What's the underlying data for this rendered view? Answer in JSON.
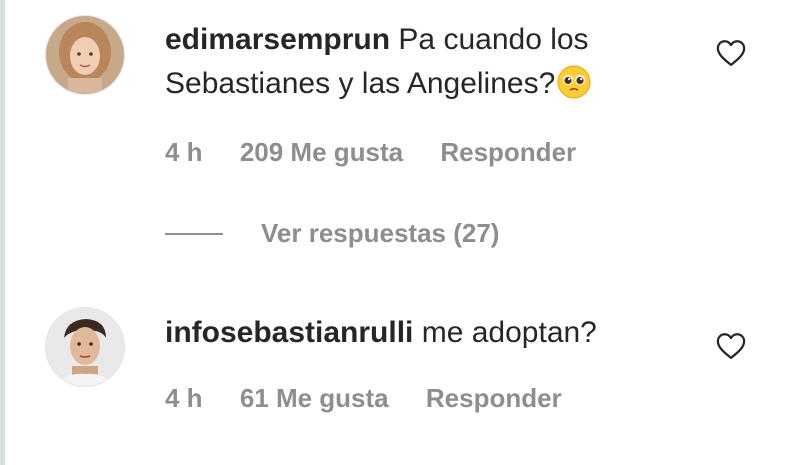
{
  "comments": [
    {
      "username": "edimarsemprun",
      "text": "Pa cuando los Sebastianes y las Angelines?",
      "emoji": "pleading-face",
      "time": "4 h",
      "likes": "209 Me gusta",
      "reply": "Responder",
      "view_replies": "Ver respuestas (27)"
    },
    {
      "username": "infosebastianrulli",
      "text": "me adoptan?",
      "time": "4 h",
      "likes": "61 Me gusta",
      "reply": "Responder"
    }
  ],
  "icons": {
    "like": "heart-outline-icon"
  },
  "colors": {
    "text": "#262626",
    "secondary": "#8e8e8e",
    "accent_rule": "#d6e2e0"
  }
}
